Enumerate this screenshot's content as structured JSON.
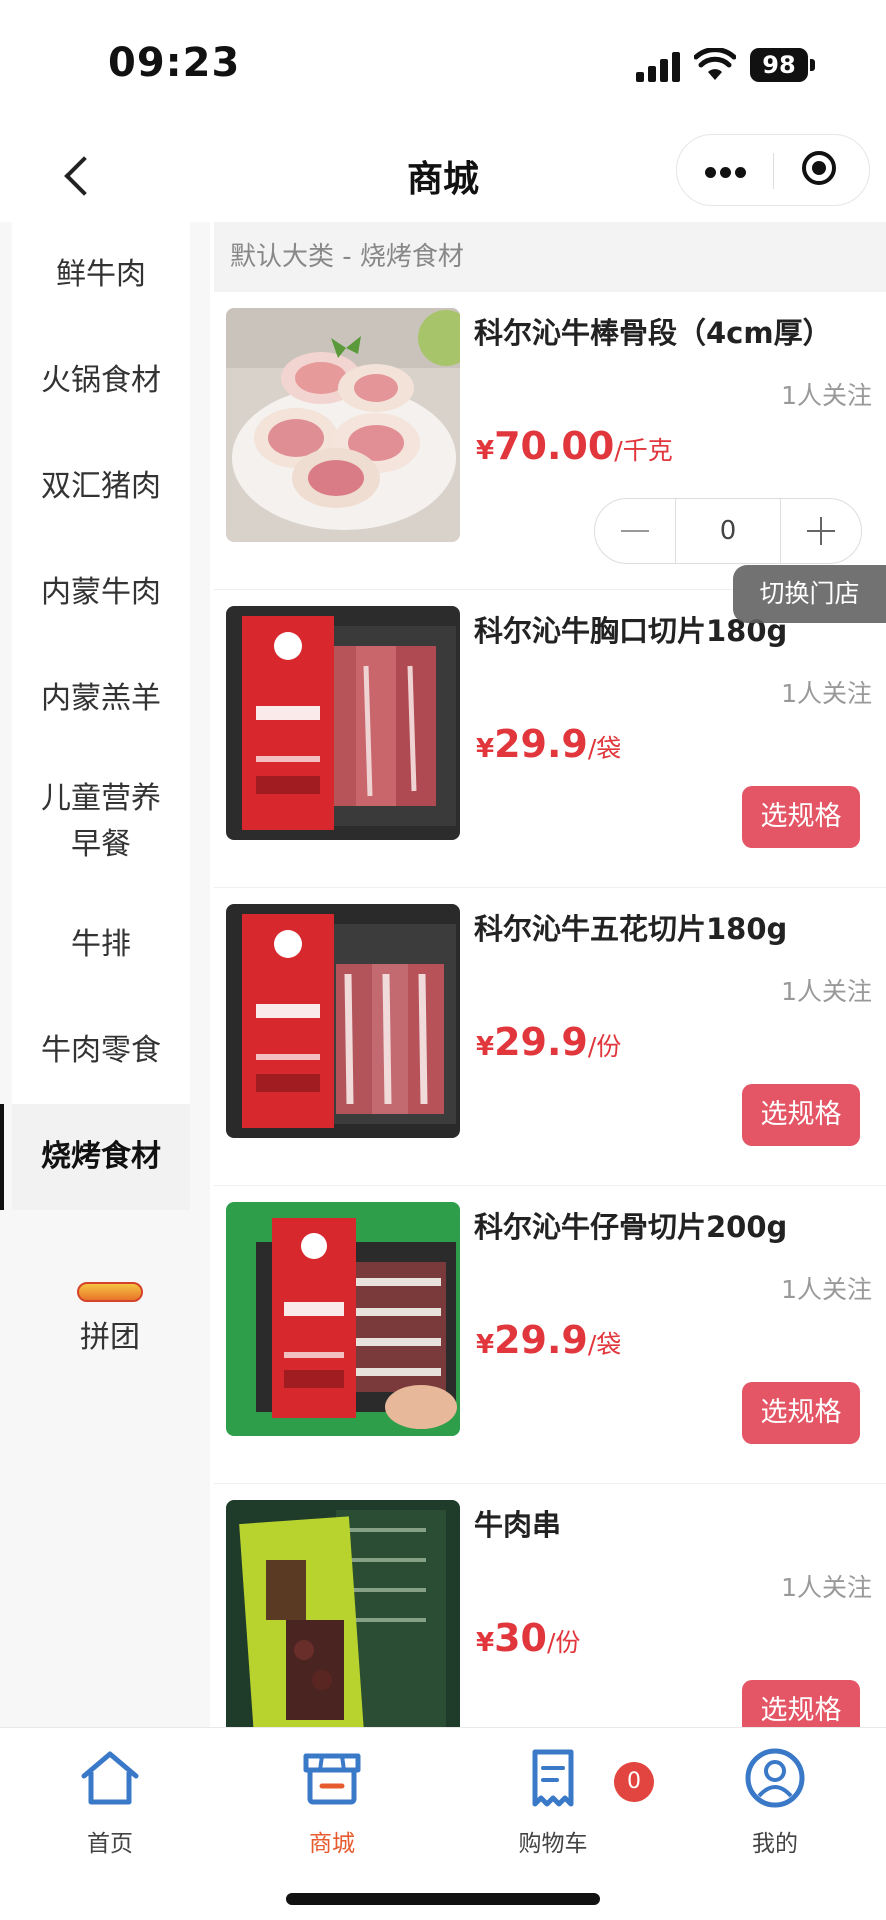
{
  "status_bar": {
    "time": "09:23",
    "battery": "98"
  },
  "nav": {
    "title": "商城"
  },
  "sidebar": {
    "items": [
      {
        "label": "鲜牛肉"
      },
      {
        "label": "火锅食材"
      },
      {
        "label": "双汇猪肉"
      },
      {
        "label": "内蒙牛肉"
      },
      {
        "label": "内蒙羔羊"
      },
      {
        "label": "儿童营养\n早餐"
      },
      {
        "label": "牛排"
      },
      {
        "label": "牛肉零食"
      },
      {
        "label": "烧烤食材",
        "active": true
      }
    ],
    "group_buy_label": "拼团"
  },
  "content": {
    "category_path": "默认大类 - 烧烤食材",
    "products": [
      {
        "name": "科尔沁牛棒骨段（4cm厚）",
        "follow": "1人关注",
        "currency": "¥",
        "price": "70.00",
        "unit": "/千克",
        "action": "stepper",
        "quantity": "0"
      },
      {
        "name": "科尔沁牛胸口切片180g",
        "follow": "1人关注",
        "currency": "¥",
        "price": "29.9",
        "unit": "/袋",
        "action": "选规格"
      },
      {
        "name": "科尔沁牛五花切片180g",
        "follow": "1人关注",
        "currency": "¥",
        "price": "29.9",
        "unit": "/份",
        "action": "选规格"
      },
      {
        "name": "科尔沁牛仔骨切片200g",
        "follow": "1人关注",
        "currency": "¥",
        "price": "29.9",
        "unit": "/袋",
        "action": "选规格"
      },
      {
        "name": "牛肉串",
        "follow": "1人关注",
        "currency": "¥",
        "price": "30",
        "unit": "/份",
        "action": "选规格"
      }
    ]
  },
  "switch_store": "切换门店",
  "tab_bar": {
    "tabs": [
      {
        "label": "首页"
      },
      {
        "label": "商城",
        "active": true
      },
      {
        "label": "购物车"
      },
      {
        "label": "我的"
      }
    ],
    "cart_count": "0"
  },
  "colors": {
    "accent": "#e45565",
    "price": "#e0363c",
    "tab_active": "#e65a2d",
    "tab_icon": "#3a78c8"
  }
}
